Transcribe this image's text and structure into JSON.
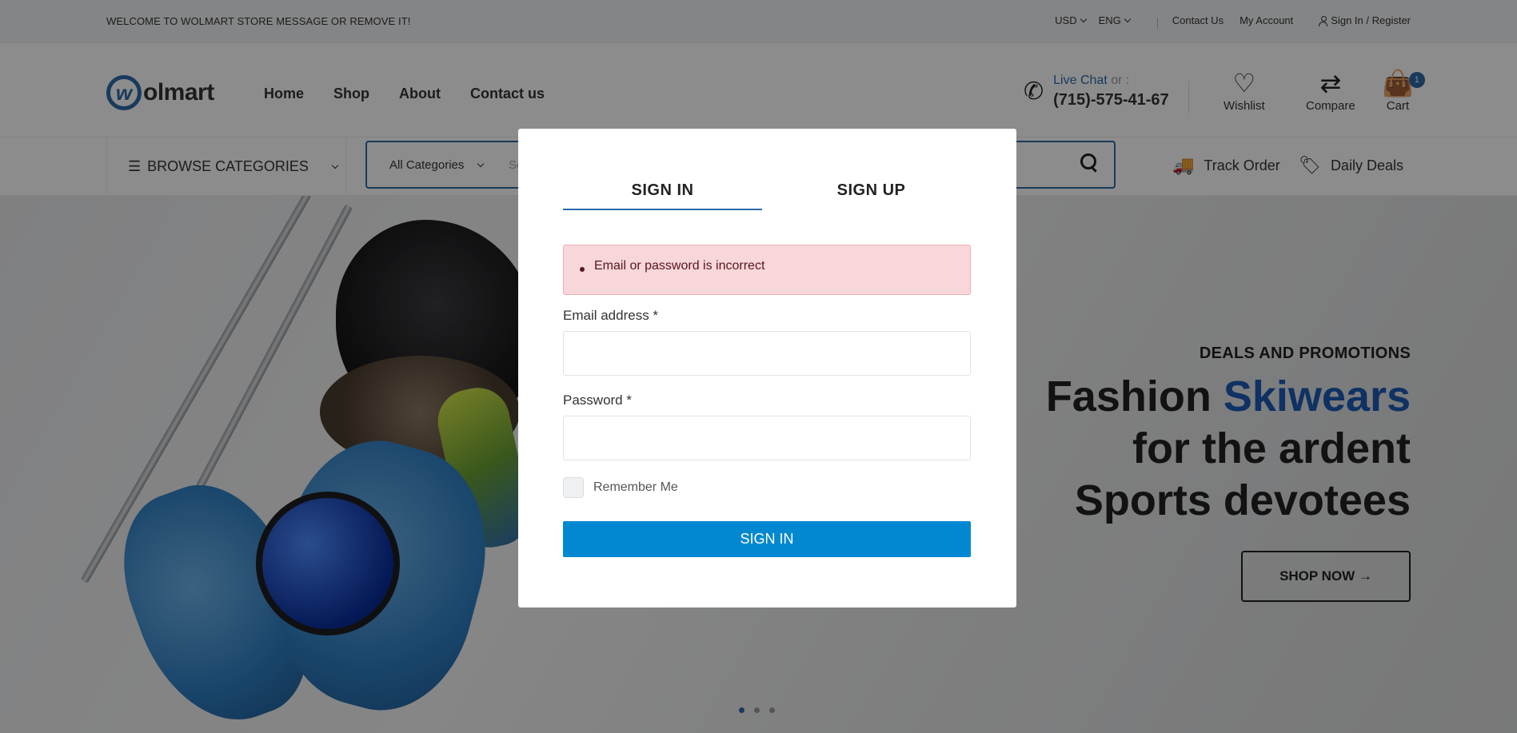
{
  "topbar": {
    "welcome": "WELCOME TO WOLMART STORE MESSAGE OR REMOVE IT!",
    "currency": "USD",
    "language": "ENG",
    "contact": "Contact Us",
    "account": "My Account",
    "signin": "Sign In / Register"
  },
  "header": {
    "logo_text": "olmart",
    "logo_letter": "w",
    "nav": [
      "Home",
      "Shop",
      "About",
      "Contact us"
    ],
    "live_chat": "Live Chat",
    "or": "or :",
    "phone": "(715)-575-41-67",
    "wishlist": "Wishlist",
    "compare": "Compare",
    "cart": "Cart",
    "cart_count": "1"
  },
  "navrow": {
    "browse": "BROWSE CATEGORIES",
    "category_select": "All Categories",
    "search_placeholder": "Se",
    "track_order": "Track Order",
    "daily_deals": "Daily Deals"
  },
  "hero": {
    "subtitle": "DEALS AND PROMOTIONS",
    "title_1": "Fashion ",
    "title_highlight": "Skiwears",
    "title_2": "for the ardent",
    "title_3": "Sports devotees",
    "cta": "SHOP NOW →"
  },
  "modal": {
    "tab_signin": "SIGN IN",
    "tab_signup": "SIGN UP",
    "error": "Email or password is incorrect",
    "email_label": "Email address *",
    "email_value": "",
    "password_label": "Password *",
    "password_value": "",
    "remember": "Remember Me",
    "submit": "SIGN IN"
  },
  "colors": {
    "accent": "#2c6aa8",
    "button": "#0288d1",
    "error_bg": "#f8d7da",
    "hero_highlight": "#1c5ab5"
  }
}
